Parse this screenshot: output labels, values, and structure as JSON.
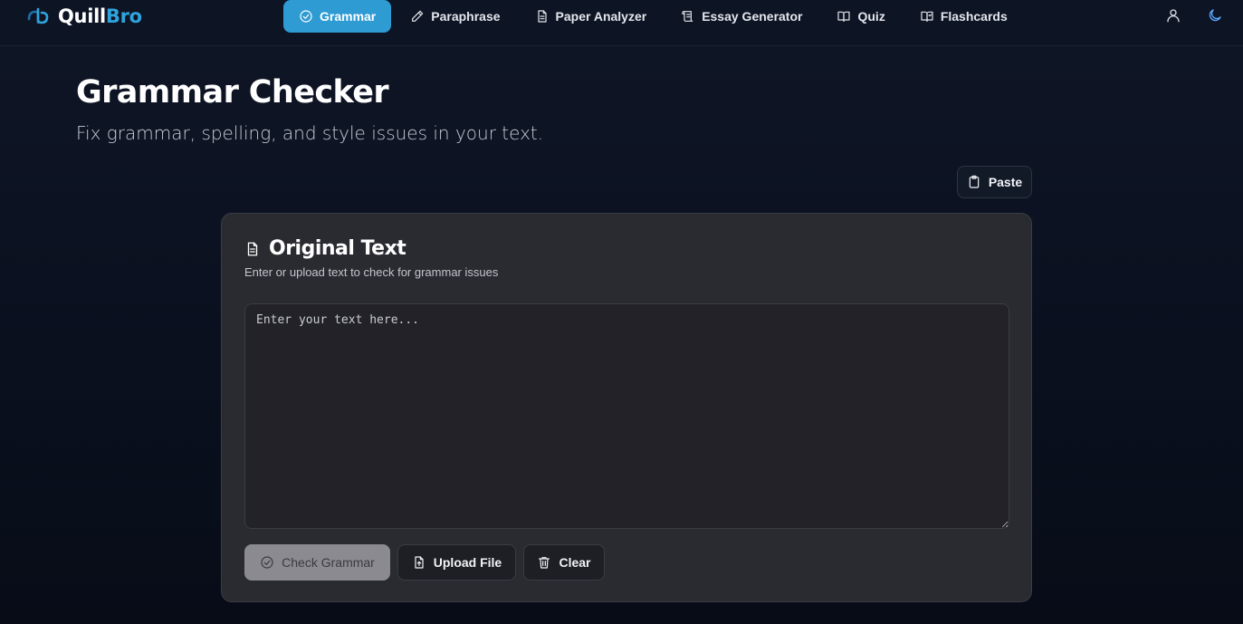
{
  "brand": {
    "name_part1": "Quill",
    "name_part2": "Bro",
    "accent": "#2e9bd3"
  },
  "nav": {
    "items": [
      {
        "label": "Grammar",
        "icon": "check-circle-icon",
        "active": true
      },
      {
        "label": "Paraphrase",
        "icon": "pencil-icon",
        "active": false
      },
      {
        "label": "Paper Analyzer",
        "icon": "document-icon",
        "active": false
      },
      {
        "label": "Essay Generator",
        "icon": "scroll-icon",
        "active": false
      },
      {
        "label": "Quiz",
        "icon": "book-open-icon",
        "active": false
      },
      {
        "label": "Flashcards",
        "icon": "book-check-icon",
        "active": false
      }
    ],
    "right_icons": [
      "user-icon",
      "moon-icon"
    ]
  },
  "header": {
    "title": "Grammar Checker",
    "subtitle": "Fix grammar, spelling, and style issues in your text."
  },
  "toolbar": {
    "paste_label": "Paste"
  },
  "card": {
    "title": "Original Text",
    "description": "Enter or upload text to check for grammar issues",
    "input_placeholder": "Enter your text here...",
    "input_value": "",
    "check_label": "Check Grammar",
    "upload_label": "Upload File",
    "clear_label": "Clear"
  }
}
